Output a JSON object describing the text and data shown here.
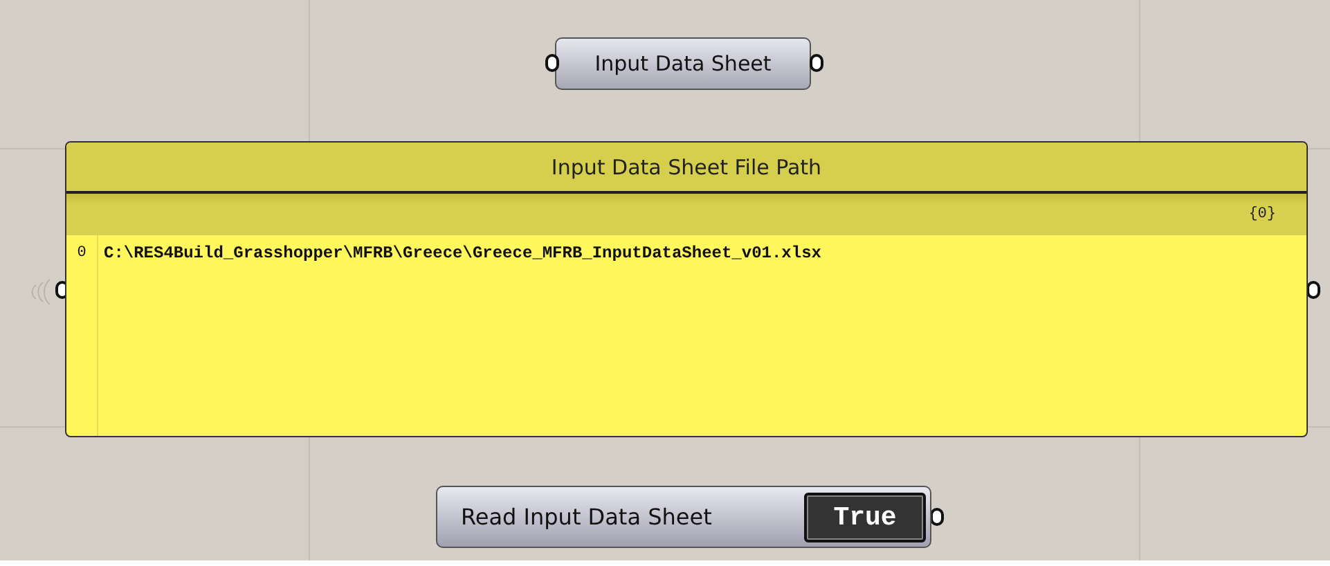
{
  "param_node": {
    "label": "Input Data Sheet"
  },
  "panel": {
    "title": "Input Data Sheet File Path",
    "path": "{0}",
    "items": [
      {
        "index": "0",
        "value": "C:\\RES4Build_Grasshopper\\MFRB\\Greece\\Greece_MFRB_InputDataSheet_v01.xlsx"
      }
    ]
  },
  "toggle": {
    "label": "Read Input Data Sheet",
    "value": "True"
  }
}
